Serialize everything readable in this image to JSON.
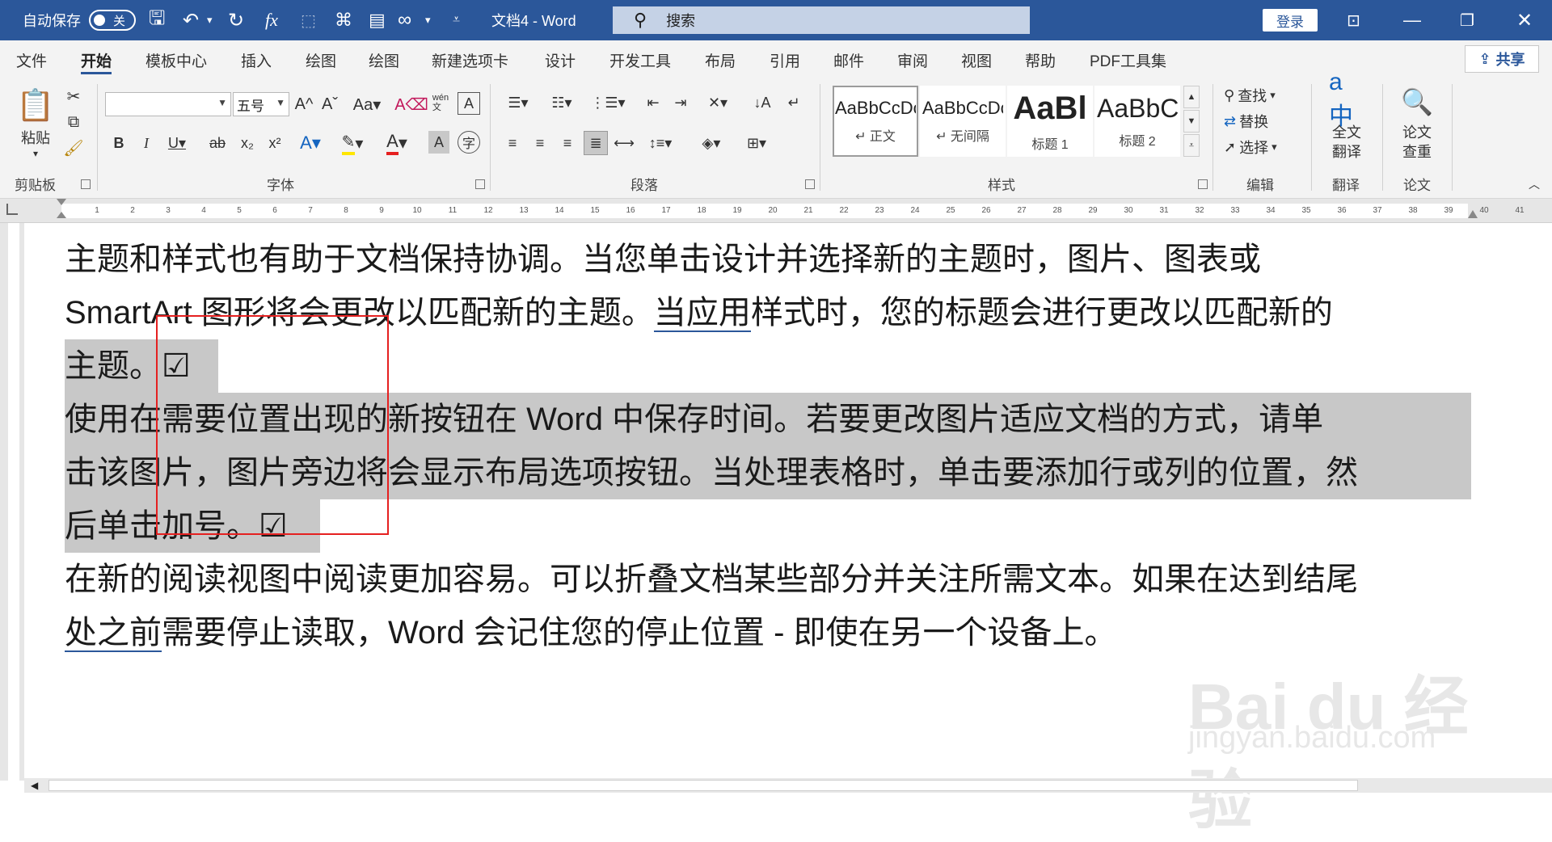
{
  "titlebar": {
    "autosave_label": "自动保存",
    "autosave_state": "关",
    "doc_title": "文档4 - Word",
    "search_placeholder": "搜索",
    "login_label": "登录"
  },
  "tabs": [
    "文件",
    "开始",
    "模板中心",
    "插入",
    "绘图",
    "绘图",
    "新建选项卡",
    "设计",
    "开发工具",
    "布局",
    "引用",
    "邮件",
    "审阅",
    "视图",
    "帮助",
    "PDF工具集"
  ],
  "share_label": "共享",
  "ribbon": {
    "clipboard": {
      "paste": "粘贴",
      "group": "剪贴板"
    },
    "font": {
      "font_name": "",
      "font_size": "五号",
      "group": "字体"
    },
    "paragraph": {
      "group": "段落"
    },
    "styles": {
      "group": "样式",
      "items": [
        {
          "preview": "AaBbCcDc",
          "name": "↵ 正文"
        },
        {
          "preview": "AaBbCcDc",
          "name": "↵ 无间隔"
        },
        {
          "preview": "AaBl",
          "name": "标题 1"
        },
        {
          "preview": "AaBbC",
          "name": "标题 2"
        }
      ]
    },
    "editing": {
      "find": "查找",
      "replace": "替换",
      "select": "选择",
      "group": "编辑"
    },
    "translate": {
      "full": "全文",
      "translate": "翻译",
      "group": "翻译"
    },
    "paper": {
      "check": "论文",
      "check2": "查重",
      "group": "论文"
    }
  },
  "ruler_ticks": [
    "1",
    "2",
    "3",
    "4",
    "5",
    "6",
    "7",
    "8",
    "9",
    "10",
    "11",
    "12",
    "13",
    "14",
    "15",
    "16",
    "17",
    "18",
    "19",
    "20",
    "21",
    "22",
    "23",
    "24",
    "25",
    "26",
    "27",
    "28",
    "29",
    "30",
    "31",
    "32",
    "33",
    "34",
    "35",
    "36",
    "37",
    "38",
    "39",
    "40",
    "41"
  ],
  "document": {
    "l1": "主题和样式也有助于文档保持协调。当您单击设计并选择新的主题时，图片、图表或",
    "l2a": "SmartArt 图形将会更改以匹配新的主题。",
    "l2b": "当应用",
    "l2c": "样式时，您的标题会进行更改以匹配新的",
    "l3": "主题。☑",
    "l4": "使用在需要位置出现的新按钮在 Word 中保存时间。若要更改图片适应文档的方式，请单",
    "l5": "击该图片，图片旁边将会显示布局选项按钮。当处理表格时，单击要添加行或列的位置，然",
    "l6": "后单击加号。☑",
    "l7": "在新的阅读视图中阅读更加容易。可以折叠文档某些部分并关注所需文本。如果在达到结尾",
    "l8a": "处之前",
    "l8b": "需要停止读取，Word 会记住您的停止位置 - 即使在另一个设备上。"
  },
  "watermark": {
    "brand": "Bai du 经验",
    "url": "jingyan.baidu.com"
  }
}
